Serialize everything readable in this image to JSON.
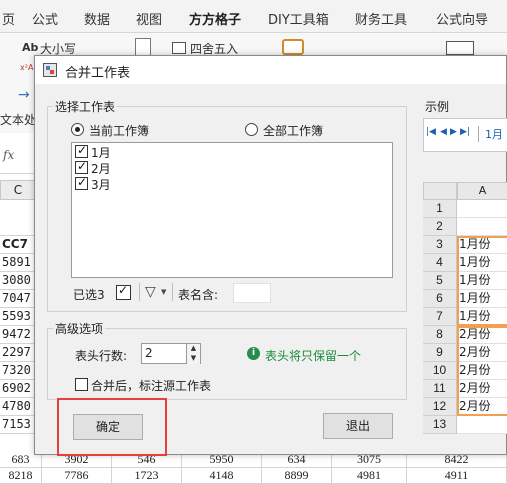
{
  "ribbon": {
    "tabs": [
      "页",
      "公式",
      "数据",
      "视图",
      "方方格子",
      "DIY工具箱",
      "财务工具",
      "公式向导"
    ],
    "active_tab": "方方格子",
    "items": {
      "case_label": "大小写",
      "case_prefix": "Ab",
      "round_label": "四舍五入",
      "text_proc_label": "文本处",
      "sup_prefix": "x²AB"
    }
  },
  "formula_bar": {
    "fx": "fx"
  },
  "sheet_left": {
    "col_header": "C",
    "cells": [
      "CC7",
      "5891",
      "3080",
      "7047",
      "5593",
      "9472",
      "2297",
      "7320",
      "6902",
      "4780",
      "7153"
    ]
  },
  "bottom_rows": [
    [
      "683",
      "3902",
      "546",
      "5950",
      "634",
      "3075",
      "8422"
    ],
    [
      "8218",
      "7786",
      "1723",
      "4148",
      "8899",
      "4981",
      "4911"
    ]
  ],
  "dialog": {
    "title": "合并工作表",
    "select_group_label": "选择工作表",
    "radio_current": "当前工作簿",
    "radio_all": "全部工作簿",
    "sheets": [
      {
        "name": "1月",
        "checked": true
      },
      {
        "name": "2月",
        "checked": true
      },
      {
        "name": "3月",
        "checked": true
      }
    ],
    "selected_count": "已选3",
    "sheet_name_contains_label": "表名含:",
    "filter_icon": "filter-icon",
    "advanced_group_label": "高级选项",
    "header_rows_label": "表头行数:",
    "header_rows_value": "2",
    "info_text": "表头将只保留一个",
    "mark_source_label": "合并后，标注源工作表",
    "ok_label": "确定",
    "exit_label": "退出",
    "preview_label": "示例"
  },
  "preview": {
    "nav_first": "|◀",
    "nav_prev": "◀",
    "nav_next": "▶",
    "nav_last": "▶|",
    "tab_label": "1月",
    "col_header": "A",
    "row_numbers": [
      "1",
      "2",
      "3",
      "4",
      "5",
      "6",
      "7",
      "8",
      "9",
      "10",
      "11",
      "12",
      "13"
    ],
    "cells": [
      "",
      "",
      "1月份",
      "1月份",
      "1月份",
      "1月份",
      "1月份",
      "2月份",
      "2月份",
      "2月份",
      "2月份",
      "2月份",
      ""
    ]
  },
  "colors": {
    "accent_green": "#217346",
    "highlight_red": "#e5403b",
    "highlight_orange": "#f0a050",
    "info_green": "#1a8a3a"
  }
}
